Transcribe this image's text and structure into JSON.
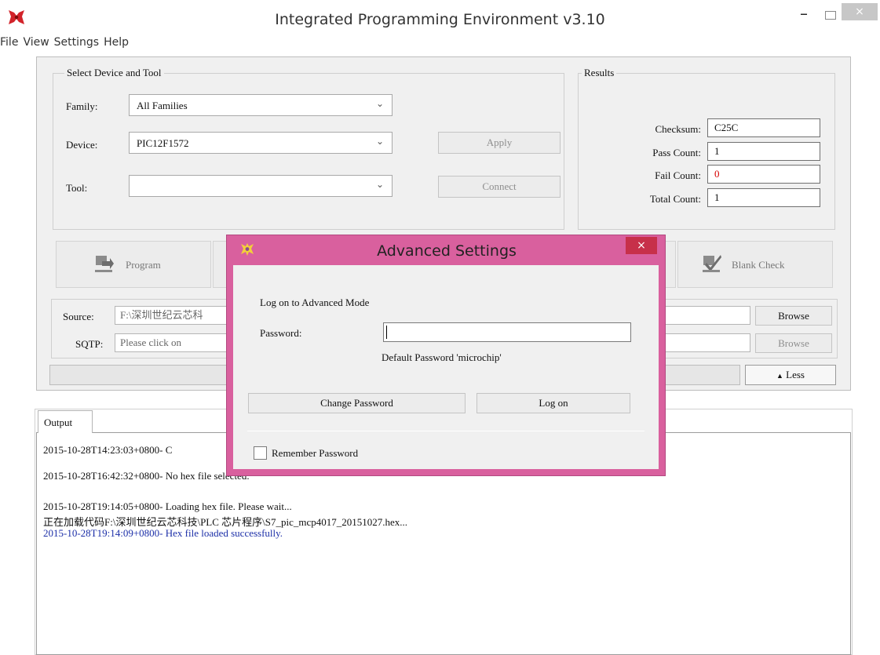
{
  "window": {
    "title": "Integrated Programming Environment v3.10",
    "min_glyph": "–",
    "close_glyph": "×"
  },
  "menu": [
    "File",
    "View",
    "Settings",
    "Help"
  ],
  "device_tool": {
    "title": "Select Device and Tool",
    "family_label": "Family:",
    "family_value": "All Families",
    "device_label": "Device:",
    "device_value": "PIC12F1572",
    "tool_label": "Tool:",
    "tool_value": "",
    "apply": "Apply",
    "connect": "Connect"
  },
  "results": {
    "title": "Results",
    "checksum_label": "Checksum:",
    "checksum": "C25C",
    "pass_label": "Pass Count:",
    "pass": "1",
    "fail_label": "Fail Count:",
    "fail": "0",
    "total_label": "Total Count:",
    "total": "1"
  },
  "actions": {
    "program": "Program",
    "blank_check": "Blank Check"
  },
  "files": {
    "source_label": "Source:",
    "source": "F:\\深圳世纪云芯科",
    "sqtp_label": "SQTP:",
    "sqtp": "Please click on",
    "browse": "Browse",
    "less": "Less"
  },
  "output": {
    "tab": "Output",
    "lines": [
      "2015-10-28T14:23:03+0800- C",
      "2015-10-28T16:42:32+0800- No hex file selected.",
      "2015-10-28T19:14:05+0800- Loading hex file. Please wait...",
      "正在加载代码F:\\深圳世纪云芯科技\\PLC 芯片程序\\S7_pic_mcp4017_20151027.hex...",
      "2015-10-28T19:14:09+0800- Hex file loaded successfully."
    ]
  },
  "dialog": {
    "title": "Advanced Settings",
    "close_glyph": "×",
    "heading": "Log on to Advanced Mode",
    "password_label": "Password:",
    "password_value": "",
    "hint": "Default Password 'microchip'",
    "change_password": "Change Password",
    "log_on": "Log on",
    "remember": "Remember Password"
  },
  "colors": {
    "dialog_frame": "#d9609e",
    "dialog_close": "#c7304a",
    "fail_count": "#d60000",
    "log_blue": "#1c2fa8"
  }
}
